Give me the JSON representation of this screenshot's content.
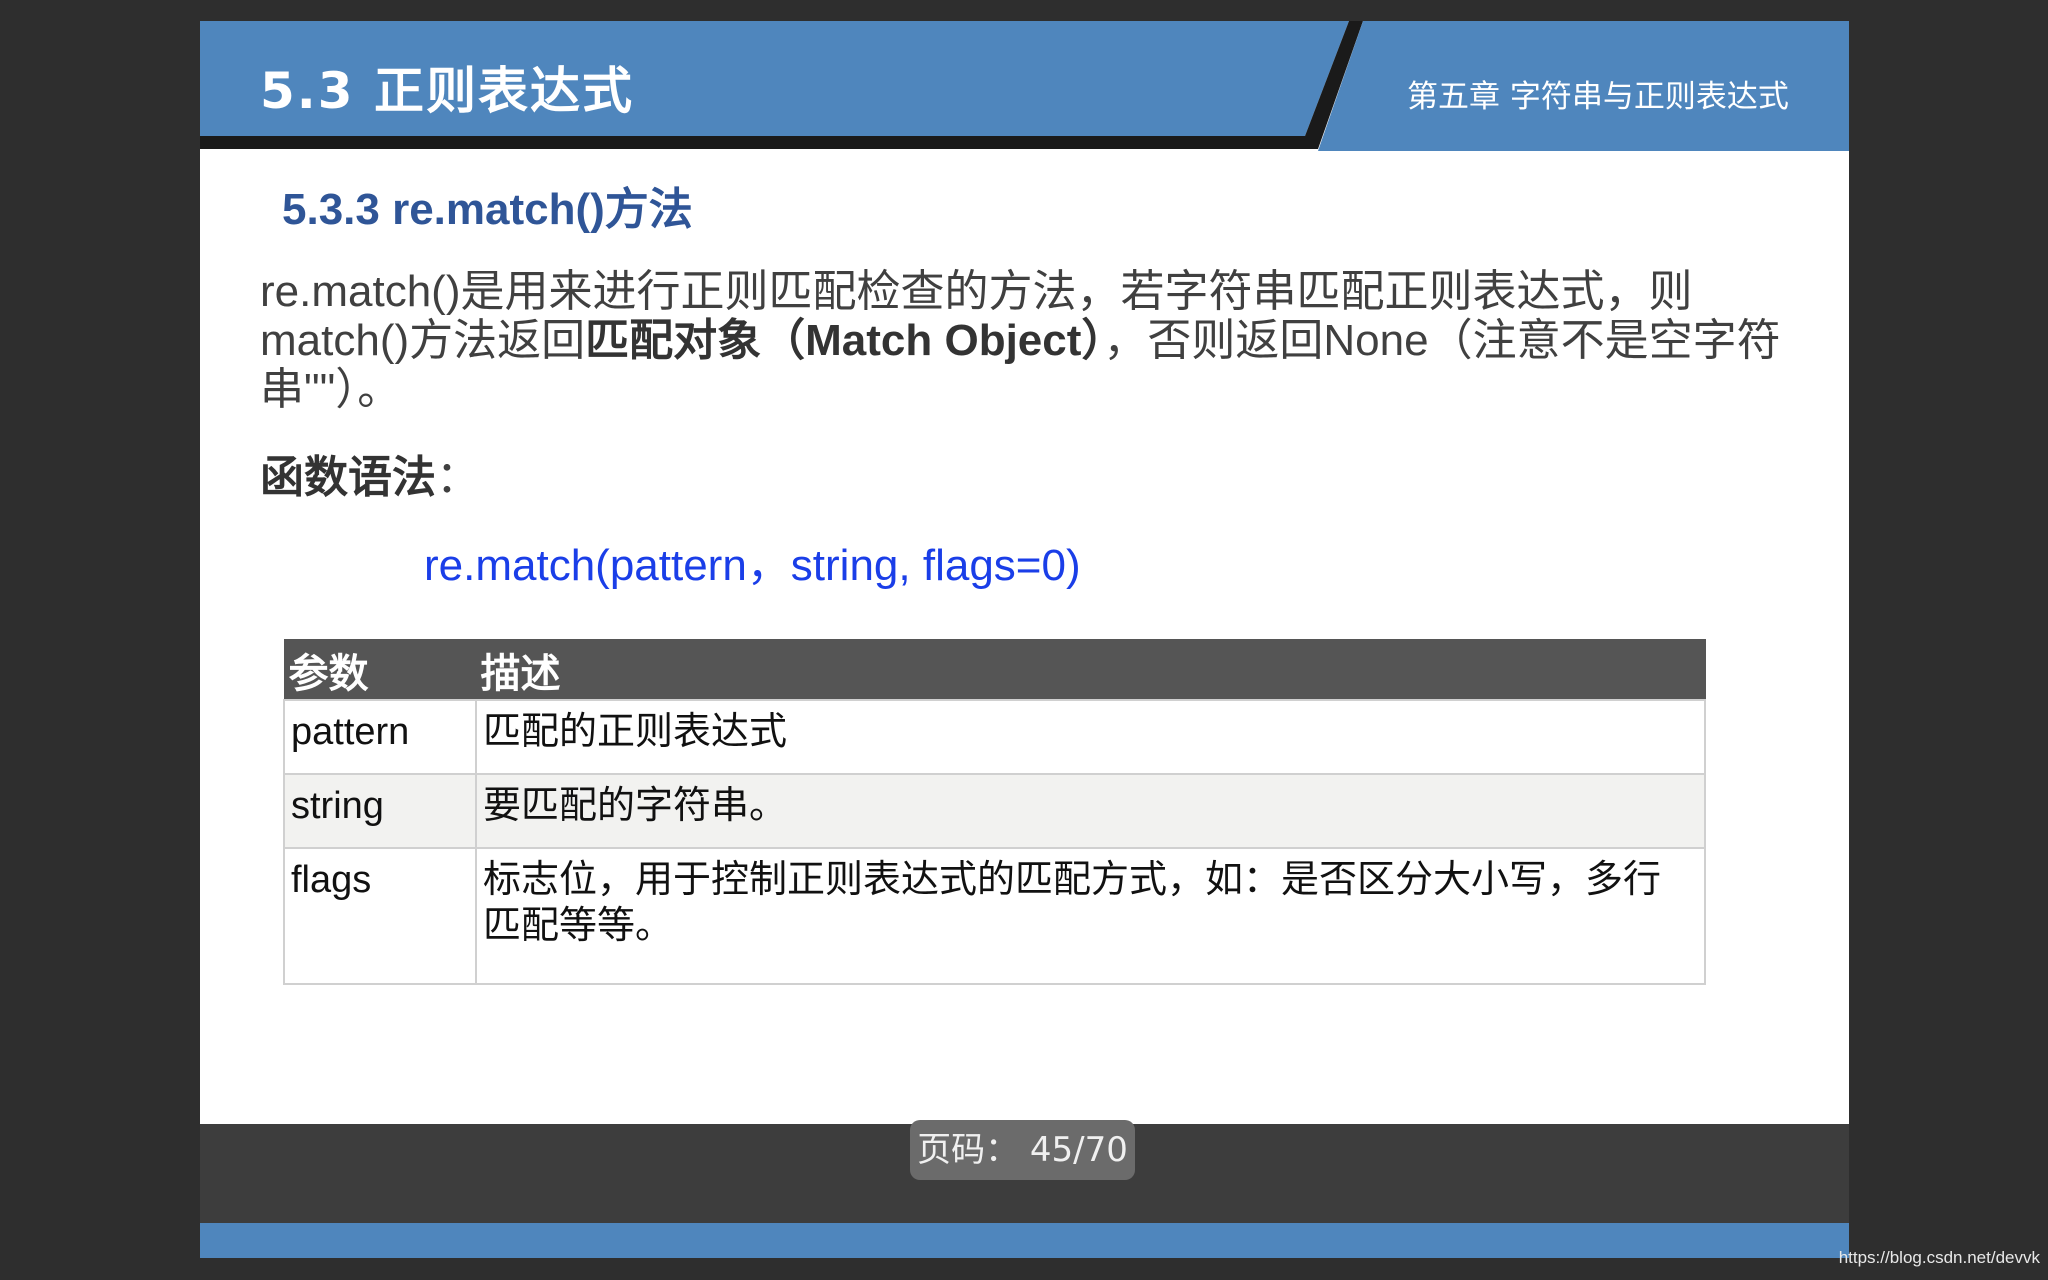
{
  "header": {
    "title": "5.3  正则表达式",
    "chapter": "第五章  字符串与正则表达式"
  },
  "colors": {
    "header_blue": "#4f86bd",
    "heading_blue": "#2f5597",
    "code_blue": "#1a3ee8",
    "table_header": "#555555",
    "viewer_background": "#2e2e2e"
  },
  "content": {
    "section_heading": "5.3.3 re.match()方法",
    "para_part1": "re.match()是用来进行正则匹配检查的方法，若字符串匹配正则表达式，则match()方法返回",
    "para_bold": "匹配对象（Match Object）",
    "para_part2": "，否则返回None（注意不是空字符串\"\"）。",
    "syntax_label": "函数语法",
    "syntax_colon": "：",
    "syntax_code": "re.match(pattern，string, flags=0)"
  },
  "table": {
    "headers": [
      "参数",
      "描述"
    ],
    "rows": [
      {
        "name": "pattern",
        "desc": "匹配的正则表达式"
      },
      {
        "name": "string",
        "desc": "要匹配的字符串。"
      },
      {
        "name": "flags",
        "desc": "标志位，用于控制正则表达式的匹配方式，如：是否区分大小写，多行匹配等等。"
      }
    ]
  },
  "footer": {
    "page_indicator": "页码： 45/70"
  },
  "watermark": "https://blog.csdn.net/devvk"
}
